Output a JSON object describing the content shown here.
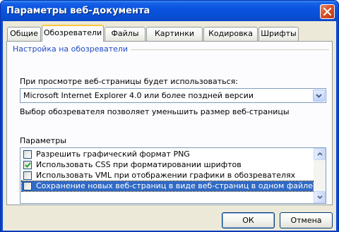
{
  "window": {
    "title": "Параметры веб-документа"
  },
  "tabs": [
    {
      "label": "Общие",
      "active": false
    },
    {
      "label": "Обозреватели",
      "active": true
    },
    {
      "label": "Файлы",
      "active": false
    },
    {
      "label": "Картинки",
      "active": false
    },
    {
      "label": "Кодировка",
      "active": false
    },
    {
      "label": "Шрифты",
      "active": false
    }
  ],
  "browser_settings": {
    "group_title": "Настройка на обозреватели",
    "view_label": "При просмотре веб-страницы будет использоваться:",
    "selected_browser": "Microsoft Internet Explorer 4.0 или более поздней версии",
    "hint": "Выбор обозревателя позволяет уменьшить размер веб-страницы"
  },
  "options": {
    "label": "Параметры",
    "items": [
      {
        "label": "Разрешить графический формат PNG",
        "checked": false,
        "selected": false
      },
      {
        "label": "Использовать CSS при форматировании шрифтов",
        "checked": true,
        "selected": false
      },
      {
        "label": "Использовать VML при отображении графики в обозревателях",
        "checked": false,
        "selected": false
      },
      {
        "label": "Сохранение новых веб-страниц в виде веб-страниц в одном файле",
        "checked": false,
        "selected": true
      }
    ]
  },
  "buttons": {
    "ok": "ОК",
    "cancel": "Отмена"
  },
  "colors": {
    "titlebar": "#0a53e0",
    "dialog_bg": "#ece9d8",
    "selection": "#316ac5",
    "group_title": "#1f4ac4"
  }
}
